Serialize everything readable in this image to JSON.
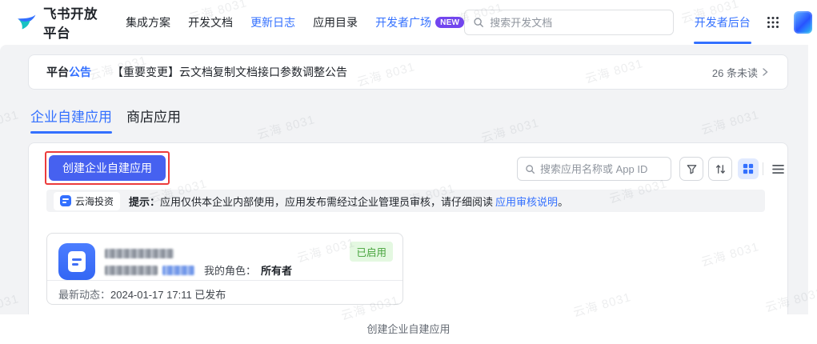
{
  "header": {
    "brand": "飞书开放平台",
    "nav": [
      {
        "label": "集成方案"
      },
      {
        "label": "开发文档"
      },
      {
        "label": "更新日志"
      },
      {
        "label": "应用目录"
      },
      {
        "label": "开发者广场",
        "badge": "NEW"
      }
    ],
    "search_placeholder": "搜索开发文档",
    "console_tab": "开发者后台"
  },
  "announcement": {
    "label_prefix": "平台",
    "label_accent": "公告",
    "title": "【重要变更】云文档复制文档接口参数调整公告",
    "unread": "26 条未读"
  },
  "tabs": [
    {
      "label": "企业自建应用",
      "active": true
    },
    {
      "label": "商店应用",
      "active": false
    }
  ],
  "panel": {
    "create_button": "创建企业自建应用",
    "search_placeholder": "搜索应用名称或 App ID"
  },
  "tip": {
    "org": "云海投资",
    "label": "提示：",
    "body": "应用仅供本企业内部使用，应用发布需经过企业管理员审核，请仔细阅读",
    "link": "应用审核说明",
    "period": "。"
  },
  "app_card": {
    "role_label": "我的角色：",
    "role_value": "所有者",
    "status": "已启用",
    "activity_label": "最新动态：",
    "activity_value": "2024-01-17 17:11 已发布"
  },
  "caption": "创建企业自建应用",
  "watermark": {
    "text": "云海 8031"
  },
  "colors": {
    "accent": "#3370ff",
    "primary-button": "#4661f0",
    "new-badge": "#7245f0",
    "status-green": "#46a33c",
    "status-green-bg": "#e4f8e1",
    "annotation-red": "#ec3b3b"
  }
}
